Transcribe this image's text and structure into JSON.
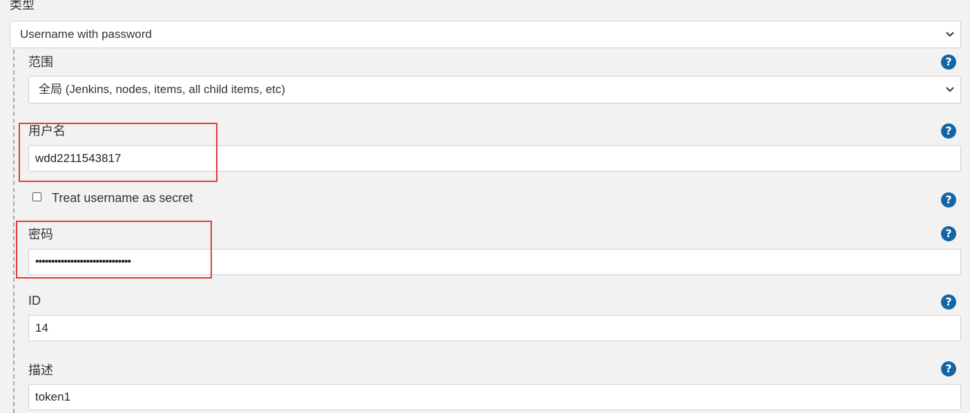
{
  "type_section": {
    "label": "类型",
    "selected": "Username with password"
  },
  "scope": {
    "label": "范围",
    "selected": "全局 (Jenkins, nodes, items, all child items, etc)"
  },
  "username": {
    "label": "用户名",
    "value": "wdd2211543817"
  },
  "treat_secret": {
    "label": "Treat username as secret",
    "checked": false
  },
  "password": {
    "label": "密码",
    "value": "••••••••••••••••••••••••••••••"
  },
  "id_field": {
    "label": "ID",
    "value": "14"
  },
  "description": {
    "label": "描述",
    "value": "token1"
  },
  "help_icon_glyph": "?",
  "colors": {
    "help_icon": "#1266a3",
    "highlight": "#e03a3a",
    "background": "#f2f2f2"
  }
}
